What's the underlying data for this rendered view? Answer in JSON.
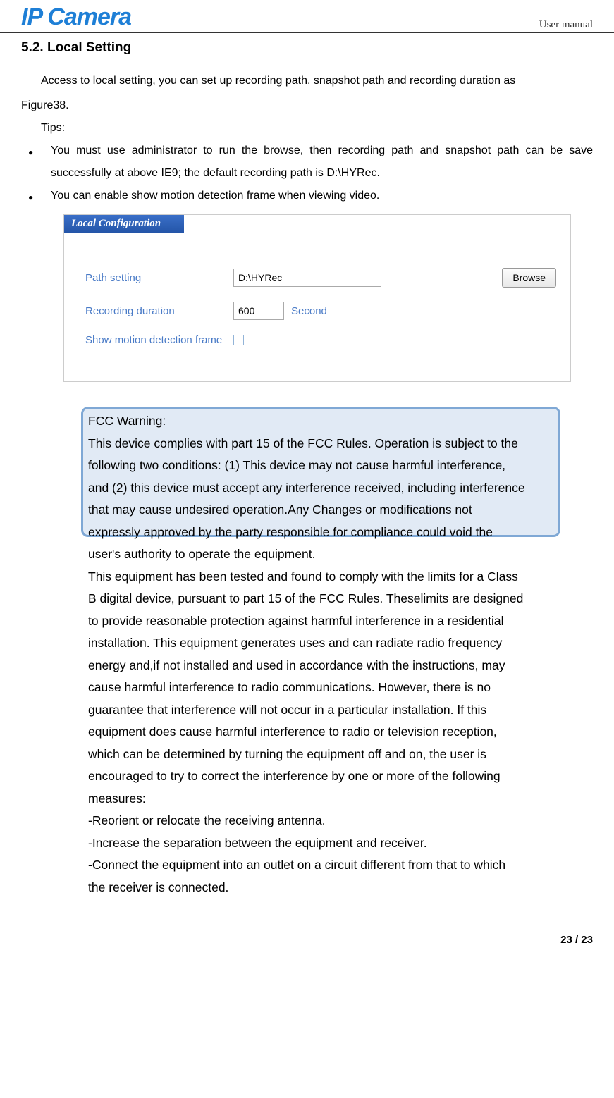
{
  "header": {
    "logo": "IP Camera",
    "right": "User manual"
  },
  "section": {
    "title": "5.2. Local Setting",
    "intro1": "Access to local setting, you can set up recording path, snapshot path and recording duration as",
    "intro2": "Figure38.",
    "tipsLabel": "Tips:",
    "bullets": [
      "You must use administrator to run the browse, then recording path and snapshot path can be save successfully at above IE9; the default recording path is D:\\HYRec.",
      "You can enable show motion detection frame when viewing video."
    ]
  },
  "panel": {
    "title": "Local Configuration",
    "pathLabel": "Path setting",
    "pathValue": "D:\\HYRec",
    "browseLabel": "Browse",
    "durationLabel": "Recording duration",
    "durationValue": "600",
    "durationUnit": "Second",
    "motionLabel": "Show motion detection frame"
  },
  "fcc": {
    "title": "FCC Warning:",
    "p1": "This device complies with part 15 of the FCC Rules. Operation is subject to the following two conditions: (1) This device may not cause harmful interference, and (2) this device must accept any interference received, including interference that may cause undesired operation.Any Changes or modifications not expressly approved by the party responsible for compliance could void the user's authority to operate the equipment.",
    "p2": "This equipment has been tested and found to comply with the limits for a Class B digital device, pursuant to part 15 of the FCC Rules. Theselimits are designed to provide reasonable protection against harmful interference in a residential installation. This equipment generates uses and can radiate radio frequency energy and,if not installed and used in accordance with the instructions, may cause harmful interference to radio communications. However, there is no guarantee that interference will not occur in a particular installation. If this equipment does cause harmful interference to radio or television reception, which can be determined by turning the equipment off and on, the user is encouraged to try to correct the interference by one or more of the following measures:",
    "m1": "-Reorient or relocate the receiving antenna.",
    "m2": "-Increase the separation between the equipment and receiver.",
    "m3": "-Connect the equipment into an outlet on a circuit different from that to which the receiver is connected."
  },
  "footer": {
    "page": "23 / 23"
  }
}
